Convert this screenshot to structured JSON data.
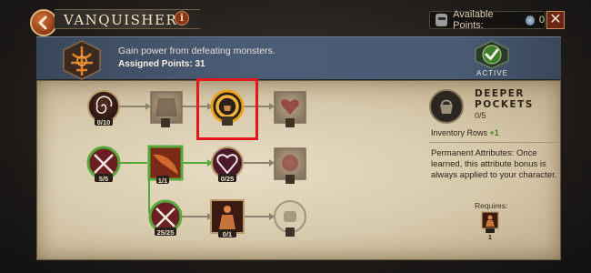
{
  "header": {
    "title": "VANQUISHER",
    "info_glyph": "i",
    "available_label": "Available Points:",
    "available_value": "0",
    "close_glyph": "✕",
    "back_icon": "chevron-left-icon"
  },
  "banner": {
    "description": "Gain power from defeating monsters.",
    "assigned_label": "Assigned Points: 31",
    "status": "ACTIVE",
    "accent_color": "#4a5b74"
  },
  "tree": {
    "nodes": [
      {
        "id": "spiral",
        "count": "0/10",
        "state": "available",
        "icon": "spiral-icon"
      },
      {
        "id": "armor",
        "count": "",
        "state": "locked",
        "icon": "armor-icon"
      },
      {
        "id": "pouch",
        "count": "",
        "state": "selected",
        "icon": "pouch-icon"
      },
      {
        "id": "heart-top",
        "count": "",
        "state": "locked",
        "icon": "heart-icon"
      },
      {
        "id": "swords-1",
        "count": "5/5",
        "state": "maxed",
        "icon": "crossed-swords-icon"
      },
      {
        "id": "dagger",
        "count": "1/1",
        "state": "maxed",
        "icon": "dagger-icon"
      },
      {
        "id": "heart-gem",
        "count": "0/25",
        "state": "available",
        "icon": "heart-gem-icon"
      },
      {
        "id": "heart-right",
        "count": "",
        "state": "locked",
        "icon": "heart-icon"
      },
      {
        "id": "swords-2",
        "count": "25/25",
        "state": "maxed",
        "icon": "crossed-swords-icon"
      },
      {
        "id": "figure",
        "count": "0/1",
        "state": "available",
        "icon": "figure-icon"
      },
      {
        "id": "fist",
        "count": "",
        "state": "locked",
        "icon": "fist-icon"
      }
    ]
  },
  "detail": {
    "name_line1": "DEEPER",
    "name_line2": "POCKETS",
    "rank": "0/5",
    "stat_label": "Inventory Rows",
    "stat_value": "+1",
    "permanent_text": "Permanent Attributes: Once learned, this attribute bonus is always applied to your character.",
    "requires_label": "Requires:",
    "requires_count": "1"
  },
  "colors": {
    "maxed_green": "#4f9a2a",
    "selected_gold": "#e8a21c",
    "highlight_red": "#e3161b",
    "link_green": "#56a83a",
    "link_gray": "#8c8271"
  }
}
